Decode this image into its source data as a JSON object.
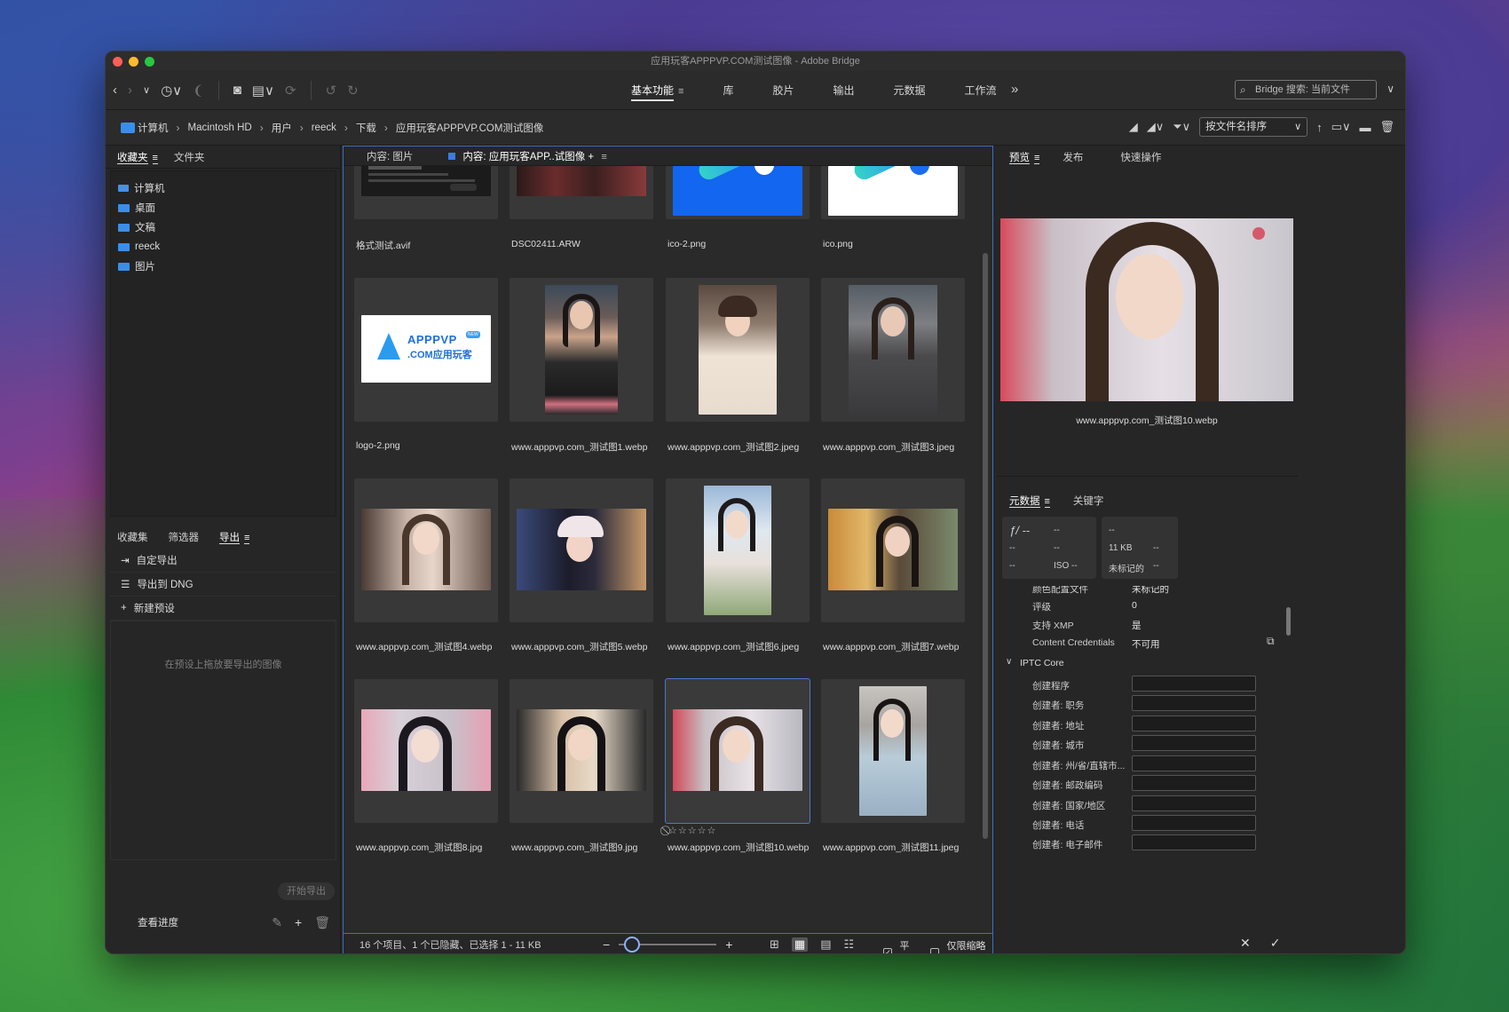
{
  "window": {
    "title": "应用玩客APPPVP.COM测试图像 - Adobe Bridge"
  },
  "workspaces": [
    {
      "label": "基本功能",
      "active": true
    },
    {
      "label": "库"
    },
    {
      "label": "胶片"
    },
    {
      "label": "输出"
    },
    {
      "label": "元数据"
    },
    {
      "label": "工作流"
    }
  ],
  "search": {
    "placeholder": "Bridge 搜索: 当前文件"
  },
  "path": [
    "计算机",
    "Macintosh HD",
    "用户",
    "reeck",
    "下载",
    "应用玩客APPPVP.COM测试图像"
  ],
  "sort": {
    "label": "按文件名排序"
  },
  "left": {
    "tabs": [
      "收藏夹",
      "文件夹"
    ],
    "favorites": [
      "计算机",
      "桌面",
      "文稿",
      "reeck",
      "图片"
    ],
    "tabs2": [
      "收藏集",
      "筛选器",
      "导出"
    ],
    "export_items": [
      "自定导出",
      "导出到 DNG",
      "新建预设"
    ],
    "drop_hint": "在预设上拖放要导出的图像",
    "start_export": "开始导出",
    "progress": "查看进度"
  },
  "center": {
    "tabs": [
      "内容: 图片",
      "内容: 应用玩客APP..试图像"
    ],
    "items": [
      {
        "name": "格式测试.avif"
      },
      {
        "name": "DSC02411.ARW"
      },
      {
        "name": "ico-2.png"
      },
      {
        "name": "ico.png"
      },
      {
        "name": "logo-2.png",
        "logo_text_1": "APPPVP",
        "logo_text_2": ".COM应用玩客",
        "logo_badge": "NEW"
      },
      {
        "name": "www.apppvp.com_测试图1.webp"
      },
      {
        "name": "www.apppvp.com_测试图2.jpeg"
      },
      {
        "name": "www.apppvp.com_测试图3.jpeg"
      },
      {
        "name": "www.apppvp.com_测试图4.webp"
      },
      {
        "name": "www.apppvp.com_测试图5.webp"
      },
      {
        "name": "www.apppvp.com_测试图6.jpeg"
      },
      {
        "name": "www.apppvp.com_测试图7.webp"
      },
      {
        "name": "www.apppvp.com_测试图8.jpg"
      },
      {
        "name": "www.apppvp.com_测试图9.jpg"
      },
      {
        "name": "www.apppvp.com_测试图10.webp",
        "selected": true,
        "stars": "⃠☆☆☆☆☆"
      },
      {
        "name": "www.apppvp.com_测试图11.jpeg"
      }
    ],
    "status": "16 个项目、1 个已隐藏、已选择 1 - 11 KB",
    "check_tile": "平铺",
    "check_thumbs": "仅限缩略图"
  },
  "right": {
    "tabs": [
      "预览",
      "发布",
      "快速操作"
    ],
    "preview_caption": "www.apppvp.com_测试图10.webp",
    "meta_tabs": [
      "元数据",
      "关键字"
    ],
    "meta_box1": {
      "aperture": "ƒ/ --",
      "v1": "--",
      "v2": "--",
      "v3": "--",
      "v4": "--",
      "iso": "ISO --"
    },
    "meta_box2": {
      "v1": "--",
      "size": "11 KB",
      "v2": "--",
      "label": "未标记的",
      "v3": "--"
    },
    "file_props": [
      {
        "label": "颜色配置文件",
        "value": "未标记的"
      },
      {
        "label": "评级",
        "value": "0"
      },
      {
        "label": "支持 XMP",
        "value": "是"
      },
      {
        "label": "Content Credentials",
        "value": "不可用"
      }
    ],
    "iptc_title": "IPTC Core",
    "iptc_fields": [
      "创建程序",
      "创建者: 职务",
      "创建者: 地址",
      "创建者: 城市",
      "创建者: 州/省/直辖市...",
      "创建者: 邮政编码",
      "创建者: 国家/地区",
      "创建者: 电话",
      "创建者: 电子邮件"
    ]
  }
}
